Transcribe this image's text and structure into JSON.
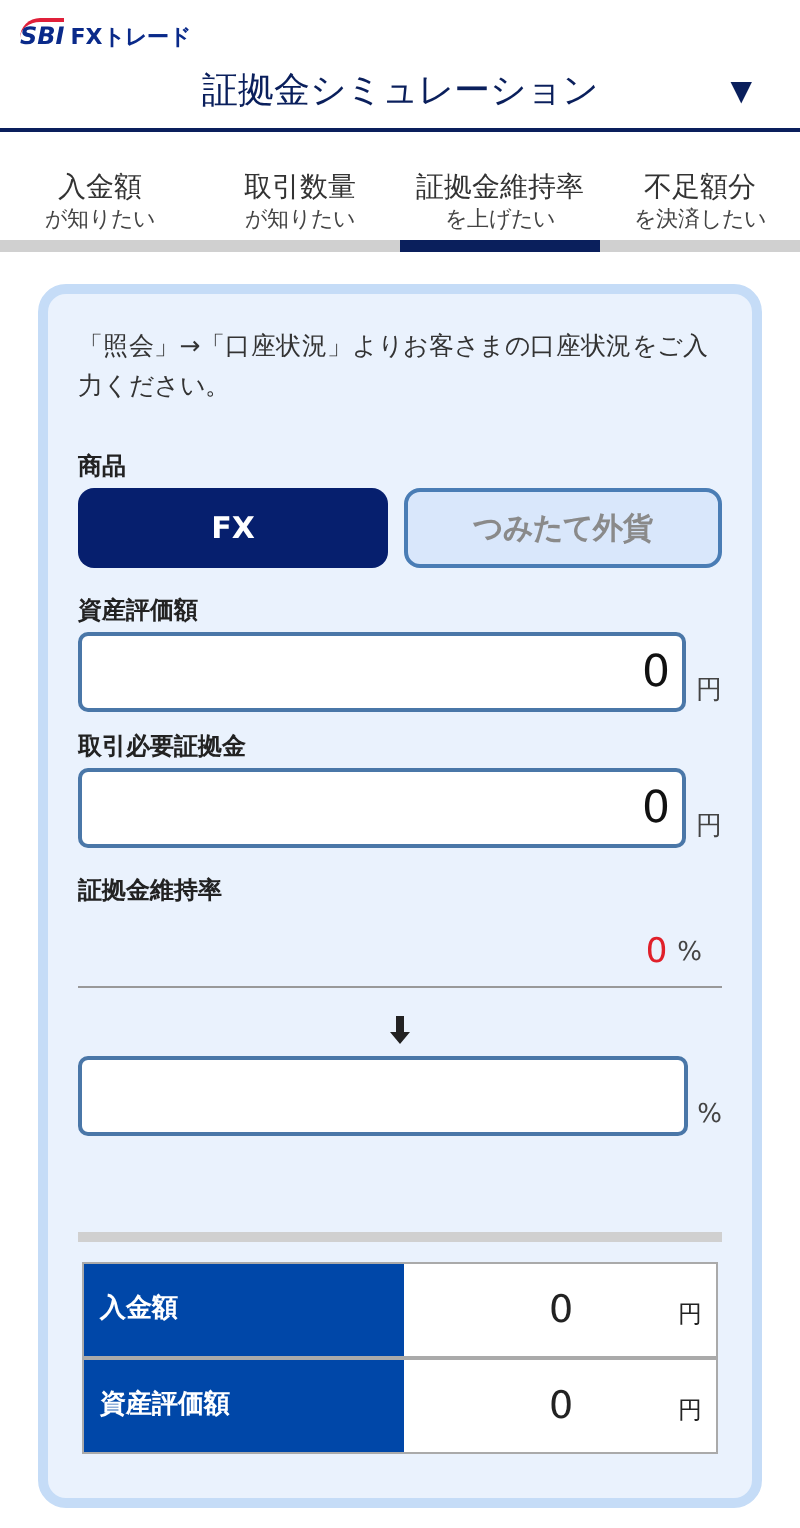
{
  "header": {
    "logo_brand": "SBI",
    "logo_text": "FXトレード",
    "title": "証拠金シミュレーション",
    "menu_icon": "▼"
  },
  "tabs": [
    {
      "label": "入金額",
      "sub": "が知りたい",
      "selected": false
    },
    {
      "label": "取引数量",
      "sub": "が知りたい",
      "selected": false
    },
    {
      "label": "証拠金維持率",
      "sub": "を上げたい",
      "selected": true
    },
    {
      "label": "不足額分",
      "sub": "を決済したい",
      "selected": false
    }
  ],
  "instruction": "「照会」→「口座状況」よりお客さまの口座状況をご入力ください。",
  "product": {
    "label": "商品",
    "options": [
      {
        "label": "FX",
        "selected": true
      },
      {
        "label": "つみたて外貨",
        "selected": false
      }
    ]
  },
  "fields": [
    {
      "label": "資産評価額",
      "value": "0",
      "unit": "円"
    },
    {
      "label": "取引必要証拠金",
      "value": "0",
      "unit": "円"
    }
  ],
  "current_rate": {
    "label": "証拠金維持率",
    "value": "0",
    "unit": "%"
  },
  "target_rate": {
    "unit": "%"
  },
  "results": [
    {
      "label": "入金額",
      "value": "0",
      "unit": "円"
    },
    {
      "label": "資産評価額",
      "value": "0",
      "unit": "円"
    }
  ]
}
